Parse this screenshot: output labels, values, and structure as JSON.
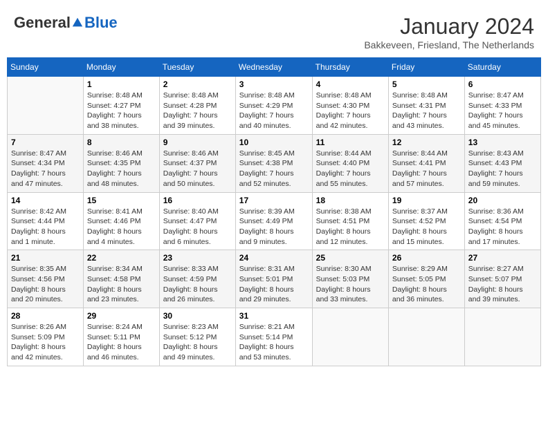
{
  "header": {
    "logo_general": "General",
    "logo_blue": "Blue",
    "month_title": "January 2024",
    "location": "Bakkeveen, Friesland, The Netherlands"
  },
  "days_of_week": [
    "Sunday",
    "Monday",
    "Tuesday",
    "Wednesday",
    "Thursday",
    "Friday",
    "Saturday"
  ],
  "weeks": [
    [
      {
        "day": "",
        "info": ""
      },
      {
        "day": "1",
        "info": "Sunrise: 8:48 AM\nSunset: 4:27 PM\nDaylight: 7 hours\nand 38 minutes."
      },
      {
        "day": "2",
        "info": "Sunrise: 8:48 AM\nSunset: 4:28 PM\nDaylight: 7 hours\nand 39 minutes."
      },
      {
        "day": "3",
        "info": "Sunrise: 8:48 AM\nSunset: 4:29 PM\nDaylight: 7 hours\nand 40 minutes."
      },
      {
        "day": "4",
        "info": "Sunrise: 8:48 AM\nSunset: 4:30 PM\nDaylight: 7 hours\nand 42 minutes."
      },
      {
        "day": "5",
        "info": "Sunrise: 8:48 AM\nSunset: 4:31 PM\nDaylight: 7 hours\nand 43 minutes."
      },
      {
        "day": "6",
        "info": "Sunrise: 8:47 AM\nSunset: 4:33 PM\nDaylight: 7 hours\nand 45 minutes."
      }
    ],
    [
      {
        "day": "7",
        "info": "Sunrise: 8:47 AM\nSunset: 4:34 PM\nDaylight: 7 hours\nand 47 minutes."
      },
      {
        "day": "8",
        "info": "Sunrise: 8:46 AM\nSunset: 4:35 PM\nDaylight: 7 hours\nand 48 minutes."
      },
      {
        "day": "9",
        "info": "Sunrise: 8:46 AM\nSunset: 4:37 PM\nDaylight: 7 hours\nand 50 minutes."
      },
      {
        "day": "10",
        "info": "Sunrise: 8:45 AM\nSunset: 4:38 PM\nDaylight: 7 hours\nand 52 minutes."
      },
      {
        "day": "11",
        "info": "Sunrise: 8:44 AM\nSunset: 4:40 PM\nDaylight: 7 hours\nand 55 minutes."
      },
      {
        "day": "12",
        "info": "Sunrise: 8:44 AM\nSunset: 4:41 PM\nDaylight: 7 hours\nand 57 minutes."
      },
      {
        "day": "13",
        "info": "Sunrise: 8:43 AM\nSunset: 4:43 PM\nDaylight: 7 hours\nand 59 minutes."
      }
    ],
    [
      {
        "day": "14",
        "info": "Sunrise: 8:42 AM\nSunset: 4:44 PM\nDaylight: 8 hours\nand 1 minute."
      },
      {
        "day": "15",
        "info": "Sunrise: 8:41 AM\nSunset: 4:46 PM\nDaylight: 8 hours\nand 4 minutes."
      },
      {
        "day": "16",
        "info": "Sunrise: 8:40 AM\nSunset: 4:47 PM\nDaylight: 8 hours\nand 6 minutes."
      },
      {
        "day": "17",
        "info": "Sunrise: 8:39 AM\nSunset: 4:49 PM\nDaylight: 8 hours\nand 9 minutes."
      },
      {
        "day": "18",
        "info": "Sunrise: 8:38 AM\nSunset: 4:51 PM\nDaylight: 8 hours\nand 12 minutes."
      },
      {
        "day": "19",
        "info": "Sunrise: 8:37 AM\nSunset: 4:52 PM\nDaylight: 8 hours\nand 15 minutes."
      },
      {
        "day": "20",
        "info": "Sunrise: 8:36 AM\nSunset: 4:54 PM\nDaylight: 8 hours\nand 17 minutes."
      }
    ],
    [
      {
        "day": "21",
        "info": "Sunrise: 8:35 AM\nSunset: 4:56 PM\nDaylight: 8 hours\nand 20 minutes."
      },
      {
        "day": "22",
        "info": "Sunrise: 8:34 AM\nSunset: 4:58 PM\nDaylight: 8 hours\nand 23 minutes."
      },
      {
        "day": "23",
        "info": "Sunrise: 8:33 AM\nSunset: 4:59 PM\nDaylight: 8 hours\nand 26 minutes."
      },
      {
        "day": "24",
        "info": "Sunrise: 8:31 AM\nSunset: 5:01 PM\nDaylight: 8 hours\nand 29 minutes."
      },
      {
        "day": "25",
        "info": "Sunrise: 8:30 AM\nSunset: 5:03 PM\nDaylight: 8 hours\nand 33 minutes."
      },
      {
        "day": "26",
        "info": "Sunrise: 8:29 AM\nSunset: 5:05 PM\nDaylight: 8 hours\nand 36 minutes."
      },
      {
        "day": "27",
        "info": "Sunrise: 8:27 AM\nSunset: 5:07 PM\nDaylight: 8 hours\nand 39 minutes."
      }
    ],
    [
      {
        "day": "28",
        "info": "Sunrise: 8:26 AM\nSunset: 5:09 PM\nDaylight: 8 hours\nand 42 minutes."
      },
      {
        "day": "29",
        "info": "Sunrise: 8:24 AM\nSunset: 5:11 PM\nDaylight: 8 hours\nand 46 minutes."
      },
      {
        "day": "30",
        "info": "Sunrise: 8:23 AM\nSunset: 5:12 PM\nDaylight: 8 hours\nand 49 minutes."
      },
      {
        "day": "31",
        "info": "Sunrise: 8:21 AM\nSunset: 5:14 PM\nDaylight: 8 hours\nand 53 minutes."
      },
      {
        "day": "",
        "info": ""
      },
      {
        "day": "",
        "info": ""
      },
      {
        "day": "",
        "info": ""
      }
    ]
  ]
}
